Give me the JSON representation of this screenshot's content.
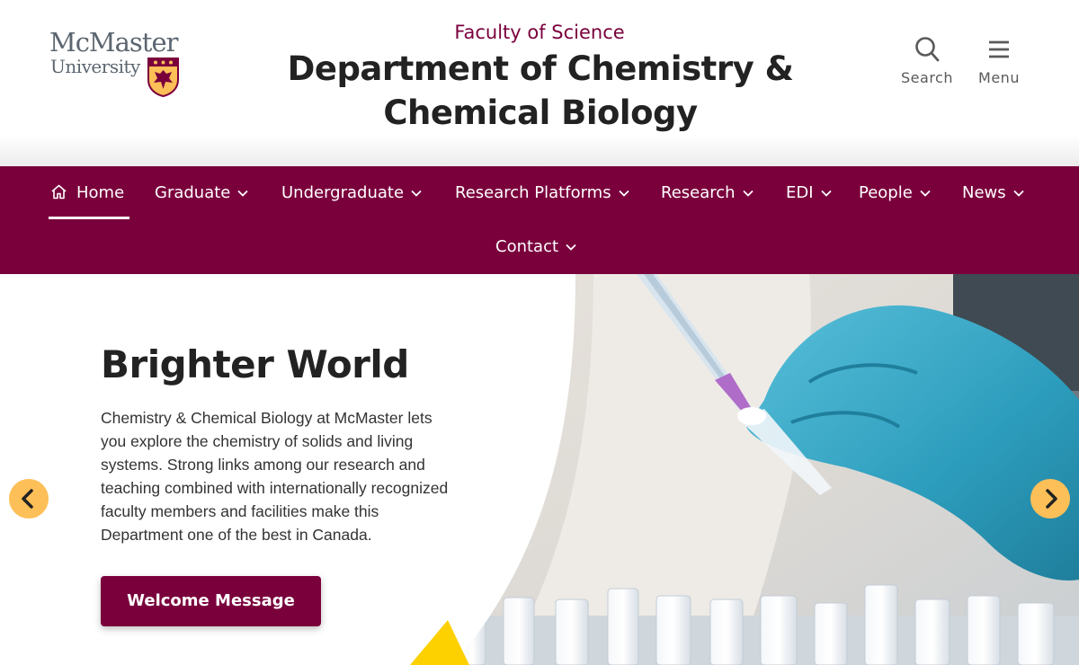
{
  "header": {
    "logo": {
      "line1": "McMaster",
      "line2": "University",
      "shield_icon": "mcmaster-shield-icon"
    },
    "faculty": "Faculty of Science",
    "department": "Department of Chemistry & Chemical Biology",
    "search": {
      "label": "Search",
      "icon": "search-icon"
    },
    "menu": {
      "label": "Menu",
      "icon": "hamburger-icon"
    }
  },
  "nav": {
    "items": [
      {
        "label": "Home",
        "icon": "home-icon",
        "active": true
      },
      {
        "label": "Graduate",
        "icon": "chevron-down-icon"
      },
      {
        "label": "Undergraduate",
        "icon": "chevron-down-icon"
      },
      {
        "label": "Research Platforms",
        "icon": "chevron-down-icon"
      },
      {
        "label": "Research",
        "icon": "chevron-down-icon"
      },
      {
        "label": "EDI",
        "icon": "chevron-down-icon"
      },
      {
        "label": "People",
        "icon": "chevron-down-icon"
      },
      {
        "label": "News",
        "icon": "chevron-down-icon"
      },
      {
        "label": "Contact",
        "icon": "chevron-down-icon"
      }
    ]
  },
  "hero": {
    "title": "Brighter World",
    "text": "Chemistry & Chemical Biology at McMaster lets you explore the chemistry of solids and living systems. Strong links among our research and teaching combined with internationally recognized faculty members and facilities make this Department one of the best in Canada.",
    "button": "Welcome Message",
    "prev_icon": "chevron-left-icon",
    "next_icon": "chevron-right-icon"
  },
  "colors": {
    "maroon": "#7a003c",
    "gold": "#fdbf57",
    "glove": "#3aa6c4",
    "text_dark": "#222222"
  }
}
